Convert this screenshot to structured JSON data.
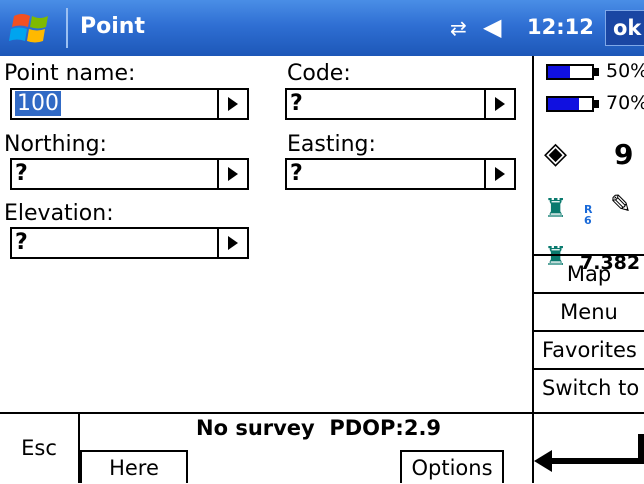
{
  "titlebar": {
    "title": "Point",
    "clock": "12:12",
    "ok_label": "ok",
    "icons": [
      "windows-start-icon",
      "network-icon",
      "volume-icon"
    ]
  },
  "form": {
    "point_name": {
      "label": "Point name:",
      "value": "100"
    },
    "code": {
      "label": "Code:",
      "value": "?"
    },
    "northing": {
      "label": "Northing:",
      "value": "?"
    },
    "easting": {
      "label": "Easting:",
      "value": "?"
    },
    "elevation": {
      "label": "Elevation:",
      "value": "?"
    }
  },
  "status_panel": {
    "battery1": {
      "text": "50%",
      "level": 0.5
    },
    "battery2": {
      "text": "70%",
      "level": 0.7
    },
    "satellites": "9",
    "rover_tag": "R\n6",
    "distance": "7.382",
    "buttons": [
      "Map",
      "Menu",
      "Favorites",
      "Switch to"
    ]
  },
  "bottom": {
    "esc_label": "Esc",
    "status_text": "No survey  PDOP:2.9",
    "here_label": "Here",
    "options_label": "Options"
  },
  "colors": {
    "titlebar": "#2f6fd3",
    "selection": "#316ac5",
    "battery_fill": "#1010e0"
  }
}
